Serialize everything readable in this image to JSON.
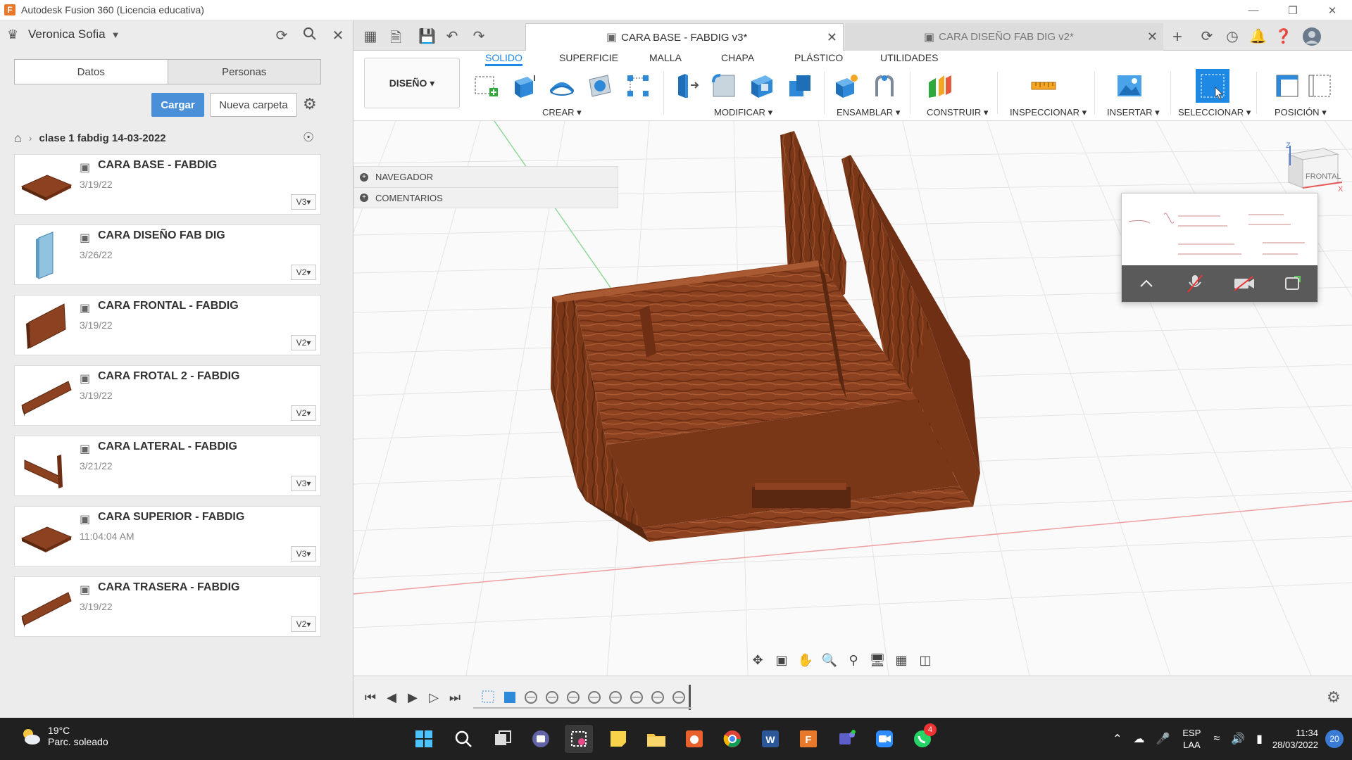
{
  "window": {
    "title": "Autodesk Fusion 360 (Licencia educativa)",
    "app_logo_letter": "F"
  },
  "datapanel": {
    "user_name": "Veronica Sofia",
    "tabs": [
      {
        "label": "Datos",
        "active": true
      },
      {
        "label": "Personas",
        "active": false
      }
    ],
    "upload_label": "Cargar",
    "new_folder_label": "Nueva carpeta",
    "breadcrumb": "clase 1 fabdig 14-03-2022",
    "files": [
      {
        "name": "CARA BASE - FABDIG",
        "date": "3/19/22",
        "version": "V3",
        "thumb": "plank-flat"
      },
      {
        "name": "CARA DISEÑO FAB DIG",
        "date": "3/26/22",
        "version": "V2",
        "thumb": "panel-glass"
      },
      {
        "name": "CARA FRONTAL - FABDIG",
        "date": "3/19/22",
        "version": "V2",
        "thumb": "plank-upright"
      },
      {
        "name": "CARA FROTAL 2 - FABDIG",
        "date": "3/19/22",
        "version": "V2",
        "thumb": "plank-diagonal"
      },
      {
        "name": "CARA LATERAL - FABDIG",
        "date": "3/21/22",
        "version": "V3",
        "thumb": "plank-side"
      },
      {
        "name": "CARA SUPERIOR - FABDIG",
        "date": "11:04:04 AM",
        "version": "V3",
        "thumb": "plank-flat"
      },
      {
        "name": "CARA TRASERA - FABDIG",
        "date": "3/19/22",
        "version": "V2",
        "thumb": "plank-diagonal"
      }
    ]
  },
  "tabs": [
    {
      "label": "CARA BASE - FABDIG v3*",
      "active": true
    },
    {
      "label": "CARA DISEÑO FAB DIG v2*",
      "active": false
    }
  ],
  "toolbar": {
    "workspace": "DISEÑO",
    "workspace_tabs": [
      "SOLIDO",
      "SUPERFICIE",
      "MALLA",
      "CHAPA",
      "PLÁSTICO",
      "UTILIDADES"
    ],
    "groups": [
      "CREAR",
      "MODIFICAR",
      "ENSAMBLAR",
      "CONSTRUIR",
      "INSPECCIONAR",
      "INSERTAR",
      "SELECCIONAR",
      "POSICIÓN"
    ]
  },
  "browser": {
    "rows": [
      "NAVEGADOR",
      "COMENTARIOS"
    ]
  },
  "viewcube": {
    "face_label": "FRONTAL",
    "axis_x": "X",
    "axis_z": "Z"
  },
  "taskbar": {
    "temperature": "19°C",
    "weather": "Parc. soleado",
    "language": "ESP",
    "language_sub": "LAA",
    "time": "11:34",
    "date": "28/03/2022",
    "notifications": "20",
    "whatsapp_badge": "4"
  },
  "colors": {
    "accent": "#1e88e5",
    "upload_button": "#4a90d9",
    "wood_dark": "#6e2f14",
    "wood_mid": "#8c4220",
    "wood_light": "#a95a32"
  }
}
